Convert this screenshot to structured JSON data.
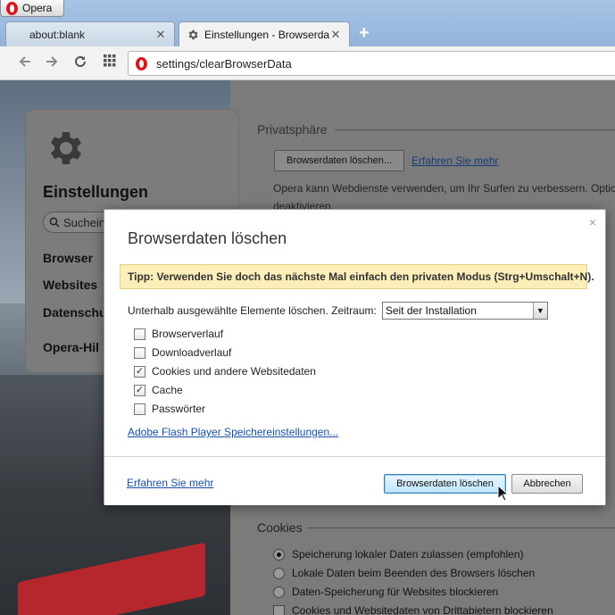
{
  "app": {
    "menu_label": "Opera"
  },
  "tabs": [
    {
      "title": "about:blank",
      "close": "✕"
    },
    {
      "title": "Einstellungen - Browserdaten löschen",
      "close": "✕"
    }
  ],
  "toolbar": {
    "back_icon": "back-arrow-icon",
    "forward_icon": "forward-arrow-icon",
    "reload_icon": "reload-icon",
    "speeddial_icon": "grid-icon",
    "url": "settings/clearBrowserData",
    "new_tab": "+"
  },
  "sidebar": {
    "title": "Einstellungen",
    "search_placeholder": "Suchein",
    "items": [
      {
        "label": "Browser"
      },
      {
        "label": "Websites"
      },
      {
        "label": "Datenschu"
      },
      {
        "label": "Opera-Hil"
      }
    ]
  },
  "page": {
    "privacy_heading": "Privatsphäre",
    "privacy_button": "Browserdaten löschen...",
    "privacy_link": "Erfahren Sie mehr",
    "privacy_desc_1": "Opera kann Webdienste verwenden, um Ihr Surfen zu verbessern. Option",
    "privacy_desc_2": "deaktivieren.",
    "cookies_heading": "Cookies",
    "cookie_options": [
      {
        "label": "Speicherung lokaler Daten zulassen (empfohlen)",
        "selected": true
      },
      {
        "label": "Lokale Daten beim Beenden des Browsers löschen",
        "selected": false
      },
      {
        "label": "Daten-Speicherung für Websites blockieren",
        "selected": false
      }
    ],
    "third_party_label": "Cookies und Websitedaten von Drittabietern blockieren"
  },
  "dialog": {
    "title": "Browserdaten löschen",
    "close": "×",
    "tip": "Tipp: Verwenden Sie doch das nächste Mal einfach den privaten Modus (Strg+Umschalt+N).",
    "range_label": "Unterhalb ausgewählte Elemente löschen. Zeitraum:",
    "range_value": "Seit der Installation",
    "options": [
      {
        "label": "Browserverlauf",
        "checked": false
      },
      {
        "label": "Downloadverlauf",
        "checked": false
      },
      {
        "label": "Cookies und andere Websitedaten",
        "checked": true
      },
      {
        "label": "Cache",
        "checked": true
      },
      {
        "label": "Passwörter",
        "checked": false
      }
    ],
    "flash_link": "Adobe Flash Player Speichereinstellungen...",
    "learn_more": "Erfahren Sie mehr",
    "confirm_button": "Browserdaten löschen",
    "cancel_button": "Abbrechen"
  }
}
